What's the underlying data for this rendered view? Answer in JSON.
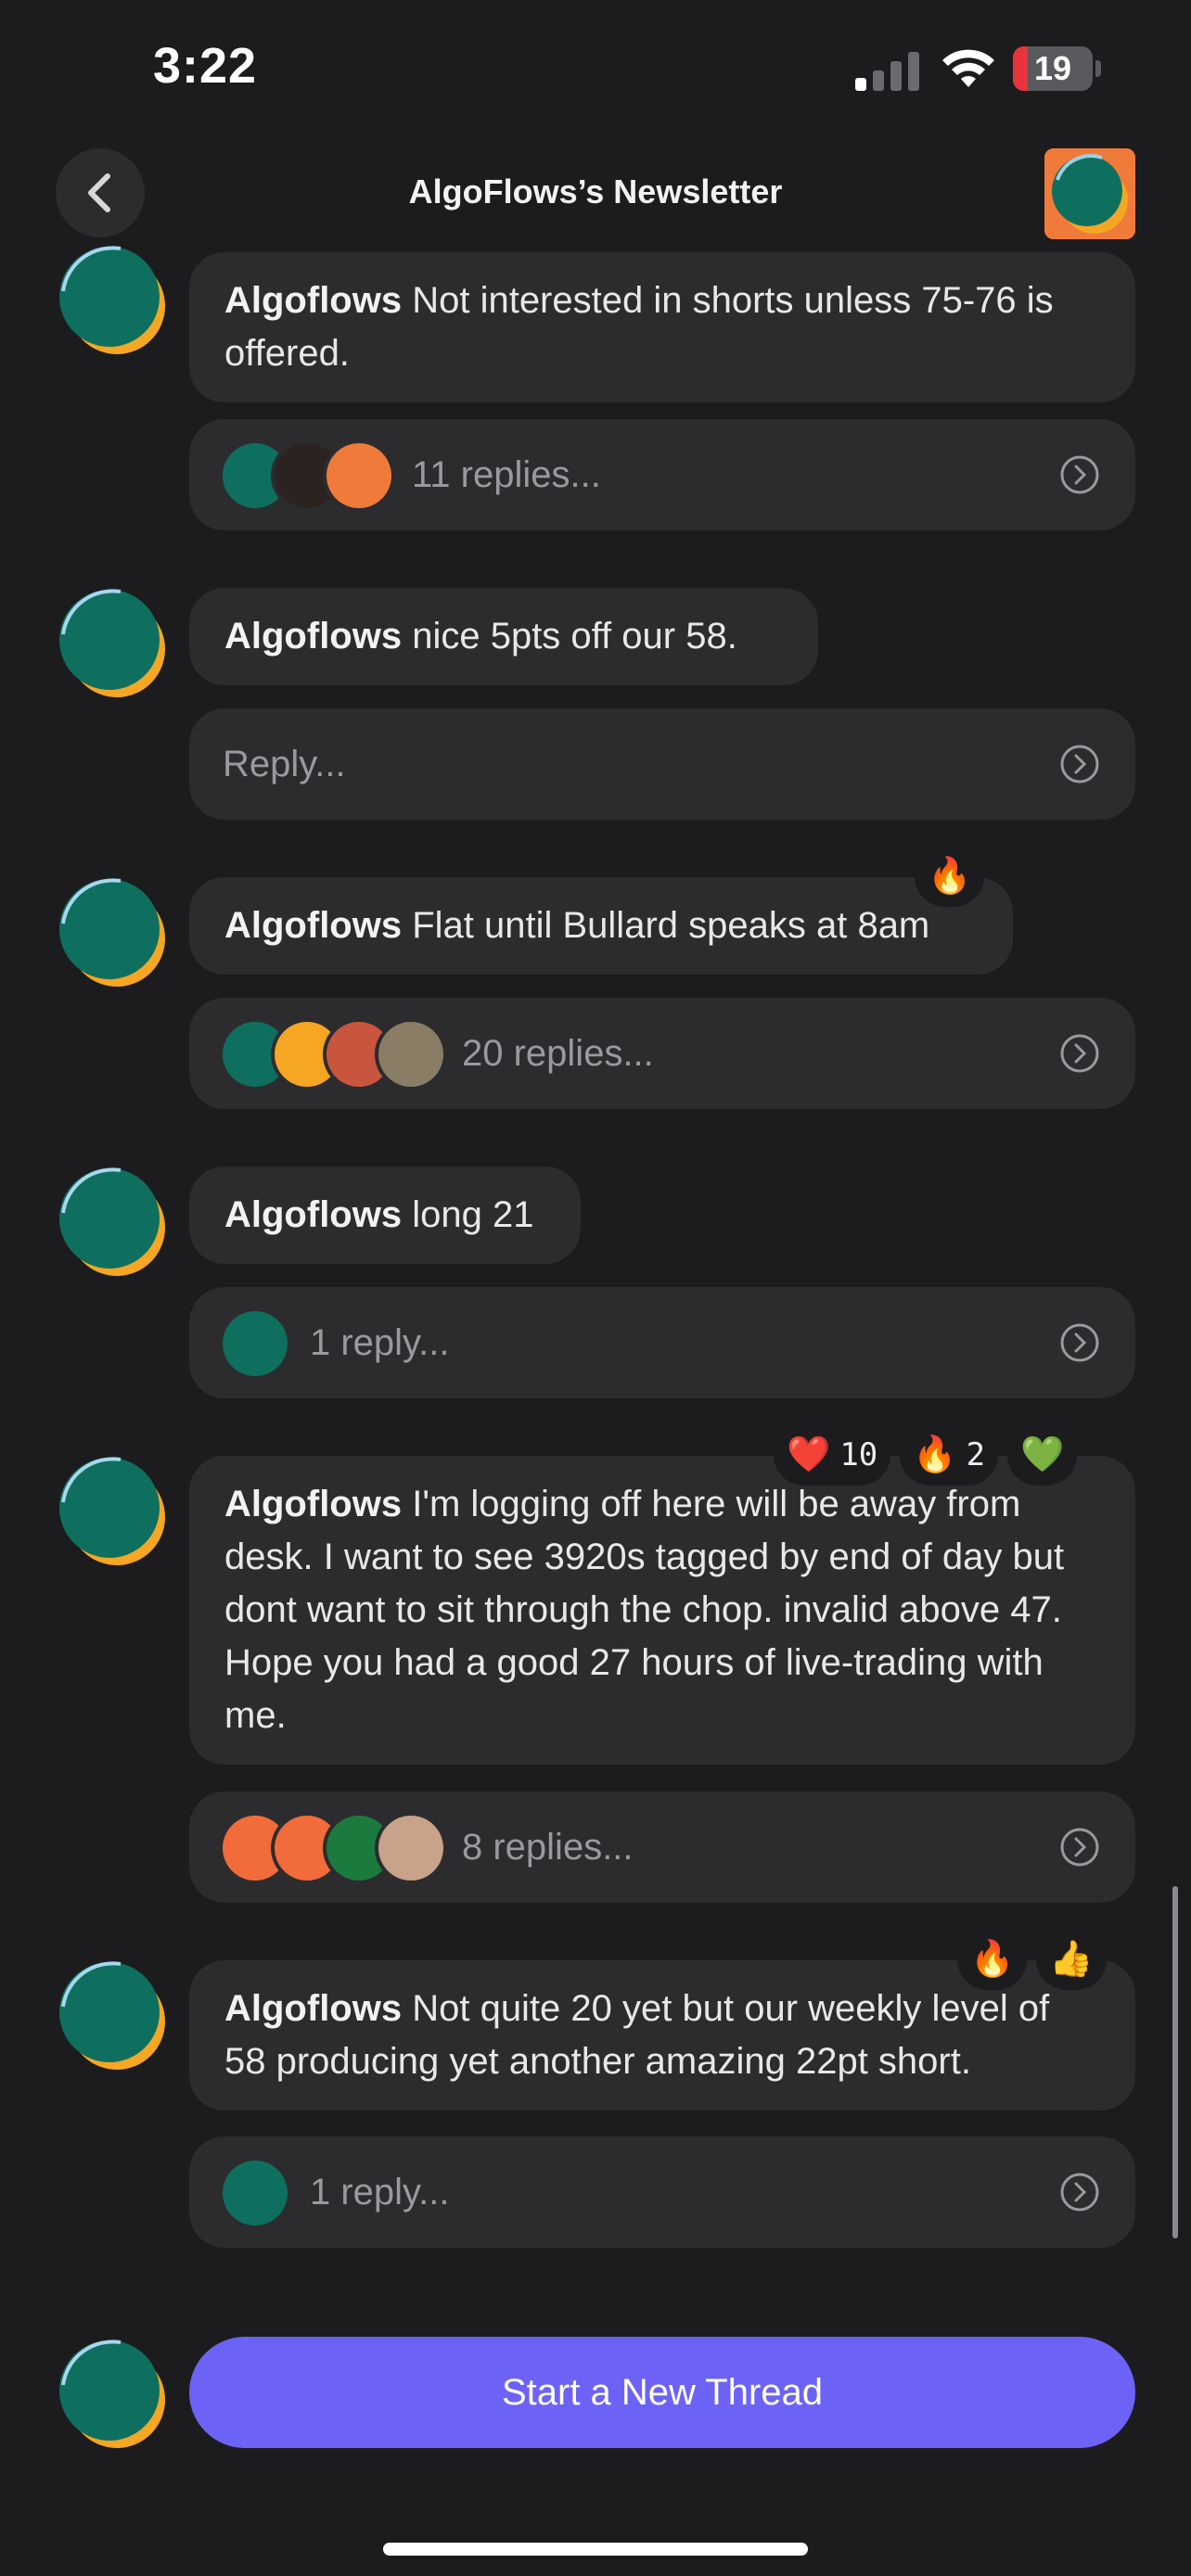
{
  "status_bar": {
    "time": "3:22",
    "battery": "19",
    "battery_fraction": 0.19
  },
  "nav": {
    "title": "AlgoFlows’s Newsletter"
  },
  "messages": [
    {
      "author": "Algoflows",
      "text": " Not interested in shorts unless 75-76 is offered.",
      "replies": "11 replies...",
      "reactions": []
    },
    {
      "author": "Algoflows",
      "text": " nice 5pts off our 58.",
      "replies": "Reply...",
      "reactions": []
    },
    {
      "author": "Algoflows",
      "text": " Flat until Bullard speaks at 8am",
      "replies": "20 replies...",
      "reactions": [
        {
          "emoji": "🔥",
          "count": ""
        }
      ]
    },
    {
      "author": "Algoflows",
      "text": " long 21",
      "replies": "1 reply...",
      "reactions": []
    },
    {
      "author": "Algoflows",
      "text": " I'm logging off here will be away from desk. I want to see 3920s tagged by end of day but dont want to sit through the chop. invalid above 47. Hope you had a good 27 hours of live-trading with me.",
      "replies": "8 replies...",
      "reactions": [
        {
          "emoji": "❤️",
          "count": "10"
        },
        {
          "emoji": "🔥",
          "count": "2"
        },
        {
          "emoji": "💚",
          "count": ""
        }
      ]
    },
    {
      "author": "Algoflows",
      "text": " Not quite 20 yet but our weekly level of 58 producing yet another amazing 22pt short.",
      "replies": "1 reply...",
      "reactions": [
        {
          "emoji": "🔥",
          "count": ""
        },
        {
          "emoji": "👍",
          "count": ""
        }
      ]
    }
  ],
  "new_thread_button": "Start a New Thread",
  "colors": {
    "background": "#1c1c1e",
    "bubble": "#2c2c2e",
    "accent": "#6c63f6",
    "avatar_teal": "#0f6f5e",
    "avatar_orange": "#f5a623"
  },
  "icons": [
    "chevron-left-icon",
    "chevron-right-circle-icon",
    "signal-icon",
    "wifi-icon",
    "battery-icon",
    "algoflows-logo"
  ]
}
